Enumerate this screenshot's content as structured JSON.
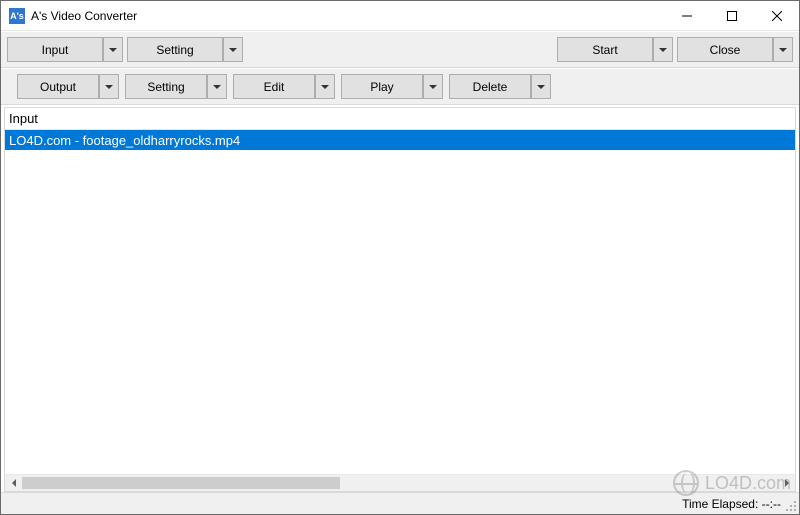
{
  "app": {
    "icon_text": "A's",
    "title": "A's Video Converter"
  },
  "window_controls": {
    "minimize": "Minimize",
    "maximize": "Maximize",
    "close": "Close"
  },
  "toolbar_top": {
    "input": "Input",
    "setting": "Setting",
    "start": "Start",
    "close": "Close"
  },
  "toolbar_secondary": {
    "output": "Output",
    "setting": "Setting",
    "edit": "Edit",
    "play": "Play",
    "delete": "Delete"
  },
  "list": {
    "column_header": "Input",
    "items": [
      {
        "label": "LO4D.com - footage_oldharryrocks.mp4",
        "selected": true
      }
    ]
  },
  "status": {
    "time_elapsed_label": "Time Elapsed:",
    "time_elapsed_value": "--:--"
  },
  "watermark": {
    "text": "LO4D.com"
  },
  "colors": {
    "selection": "#0078d7",
    "toolbar_bg": "#f0f0f0",
    "button_bg": "#e1e1e1",
    "button_border": "#adadad"
  }
}
